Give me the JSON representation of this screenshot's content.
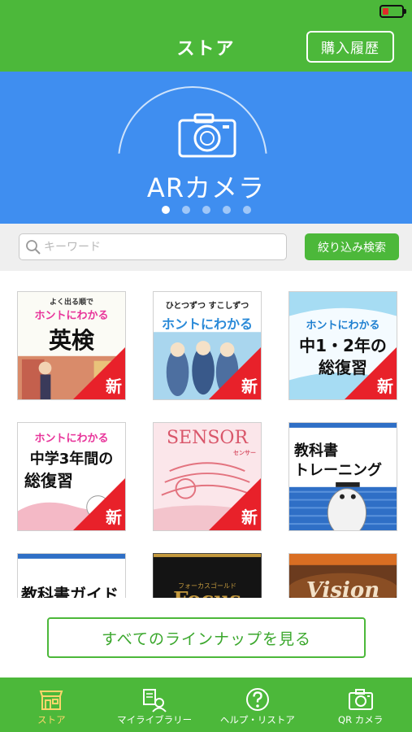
{
  "header": {
    "title": "ストア",
    "history_label": "購入履歴"
  },
  "banner": {
    "label": "ARカメラ",
    "pager_count": 5,
    "pager_active": 0
  },
  "search": {
    "placeholder": "キーワード",
    "value": "",
    "filter_label": "絞り込み検索"
  },
  "books": [
    {
      "lines": [
        "よく出る順で",
        "ホントにわかる",
        "英検"
      ],
      "new_badge": "新"
    },
    {
      "lines": [
        "ひとつずつ すこしずつ",
        "ホントにわかる"
      ],
      "new_badge": "新"
    },
    {
      "lines": [
        "ホントにわかる",
        "中1・2年の",
        "総復習"
      ],
      "new_badge": "新"
    },
    {
      "lines": [
        "ホントにわかる",
        "中学3年間の",
        "総復習"
      ],
      "new_badge": "新"
    },
    {
      "lines": [
        "SENSOR",
        "センサー"
      ],
      "new_badge": "新"
    },
    {
      "lines": [
        "教科書",
        "トレーニング"
      ],
      "new_badge": ""
    },
    {
      "lines": [
        "教科書ガイド"
      ],
      "new_badge": ""
    },
    {
      "lines": [
        "フォーカスゴールド",
        "Focus"
      ],
      "new_badge": ""
    },
    {
      "lines": [
        "Vision"
      ],
      "new_badge": ""
    }
  ],
  "lineup": {
    "label": "すべてのラインナップを見る"
  },
  "tabs": [
    {
      "label": "ストア",
      "icon": "store-icon",
      "active": true
    },
    {
      "label": "マイライブラリー",
      "icon": "library-icon",
      "active": false
    },
    {
      "label": "ヘルプ・リストア",
      "icon": "help-icon",
      "active": false
    },
    {
      "label": "QR カメラ",
      "icon": "qr-camera-icon",
      "active": false
    }
  ],
  "colors": {
    "green": "#4cb83a",
    "blue": "#3f8ef0",
    "new_badge": "#e8212a",
    "active_tab": "#ffd66b"
  }
}
